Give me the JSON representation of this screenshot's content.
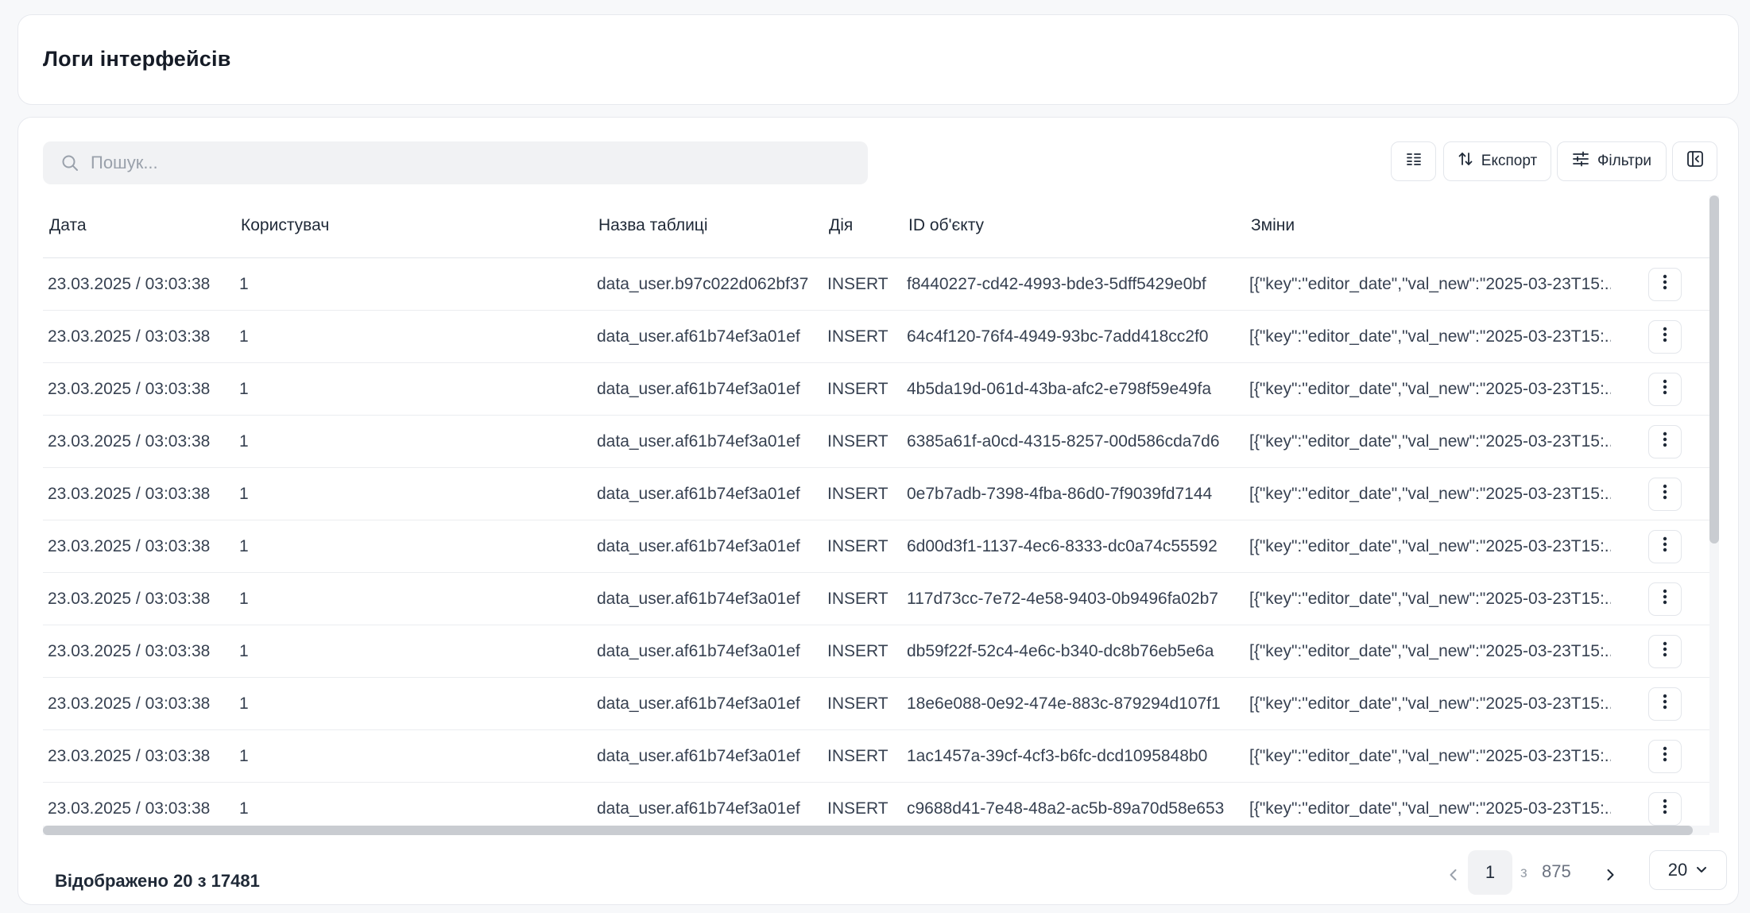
{
  "page": {
    "title": "Логи інтерфейсів"
  },
  "search": {
    "placeholder": "Пошук...",
    "value": ""
  },
  "toolbar": {
    "columns_icon": "columns-icon",
    "export_label": "Експорт",
    "export_icon": "sort-arrows-icon",
    "filters_label": "Фільтри",
    "filters_icon": "sliders-icon",
    "collapse_icon": "panel-collapse-icon"
  },
  "table": {
    "headers": [
      "Дата",
      "Користувач",
      "Назва таблиці",
      "Дія",
      "ID об'єкту",
      "Зміни"
    ],
    "rows": [
      {
        "date": "23.03.2025 / 03:03:38",
        "user": "1",
        "table_name": "data_user.b97c022d062bf37",
        "action": "INSERT",
        "object_id": "f8440227-cd42-4993-bde3-5dff5429e0bf",
        "changes": "[{\"key\":\"editor_date\",\"val_new\":\"2025-03-23T15:..."
      },
      {
        "date": "23.03.2025 / 03:03:38",
        "user": "1",
        "table_name": "data_user.af61b74ef3a01ef",
        "action": "INSERT",
        "object_id": "64c4f120-76f4-4949-93bc-7add418cc2f0",
        "changes": "[{\"key\":\"editor_date\",\"val_new\":\"2025-03-23T15:..."
      },
      {
        "date": "23.03.2025 / 03:03:38",
        "user": "1",
        "table_name": "data_user.af61b74ef3a01ef",
        "action": "INSERT",
        "object_id": "4b5da19d-061d-43ba-afc2-e798f59e49fa",
        "changes": "[{\"key\":\"editor_date\",\"val_new\":\"2025-03-23T15:..."
      },
      {
        "date": "23.03.2025 / 03:03:38",
        "user": "1",
        "table_name": "data_user.af61b74ef3a01ef",
        "action": "INSERT",
        "object_id": "6385a61f-a0cd-4315-8257-00d586cda7d6",
        "changes": "[{\"key\":\"editor_date\",\"val_new\":\"2025-03-23T15:..."
      },
      {
        "date": "23.03.2025 / 03:03:38",
        "user": "1",
        "table_name": "data_user.af61b74ef3a01ef",
        "action": "INSERT",
        "object_id": "0e7b7adb-7398-4fba-86d0-7f9039fd7144",
        "changes": "[{\"key\":\"editor_date\",\"val_new\":\"2025-03-23T15:..."
      },
      {
        "date": "23.03.2025 / 03:03:38",
        "user": "1",
        "table_name": "data_user.af61b74ef3a01ef",
        "action": "INSERT",
        "object_id": "6d00d3f1-1137-4ec6-8333-dc0a74c55592",
        "changes": "[{\"key\":\"editor_date\",\"val_new\":\"2025-03-23T15:..."
      },
      {
        "date": "23.03.2025 / 03:03:38",
        "user": "1",
        "table_name": "data_user.af61b74ef3a01ef",
        "action": "INSERT",
        "object_id": "117d73cc-7e72-4e58-9403-0b9496fa02b7",
        "changes": "[{\"key\":\"editor_date\",\"val_new\":\"2025-03-23T15:..."
      },
      {
        "date": "23.03.2025 / 03:03:38",
        "user": "1",
        "table_name": "data_user.af61b74ef3a01ef",
        "action": "INSERT",
        "object_id": "db59f22f-52c4-4e6c-b340-dc8b76eb5e6a",
        "changes": "[{\"key\":\"editor_date\",\"val_new\":\"2025-03-23T15:..."
      },
      {
        "date": "23.03.2025 / 03:03:38",
        "user": "1",
        "table_name": "data_user.af61b74ef3a01ef",
        "action": "INSERT",
        "object_id": "18e6e088-0e92-474e-883c-879294d107f1",
        "changes": "[{\"key\":\"editor_date\",\"val_new\":\"2025-03-23T15:..."
      },
      {
        "date": "23.03.2025 / 03:03:38",
        "user": "1",
        "table_name": "data_user.af61b74ef3a01ef",
        "action": "INSERT",
        "object_id": "1ac1457a-39cf-4cf3-b6fc-dcd1095848b0",
        "changes": "[{\"key\":\"editor_date\",\"val_new\":\"2025-03-23T15:..."
      },
      {
        "date": "23.03.2025 / 03:03:38",
        "user": "1",
        "table_name": "data_user.af61b74ef3a01ef",
        "action": "INSERT",
        "object_id": "c9688d41-7e48-48a2-ac5b-89a70d58e653",
        "changes": "[{\"key\":\"editor_date\",\"val_new\":\"2025-03-23T15:..."
      }
    ],
    "row_action_icon": "more-vertical-icon"
  },
  "footer": {
    "summary": "Відображено 20 з 17481",
    "current_page": "1",
    "separator": "з",
    "total_pages": "875",
    "page_size": "20",
    "prev_icon": "chevron-left-icon",
    "next_icon": "chevron-right-icon",
    "page_size_icon": "chevron-down-icon"
  },
  "colors": {
    "background": "#f7f8fa",
    "card": "#ffffff",
    "border": "#e7e9ee",
    "search_bg": "#f1f2f4",
    "text": "#1f2937",
    "muted": "#9aa1ab"
  }
}
